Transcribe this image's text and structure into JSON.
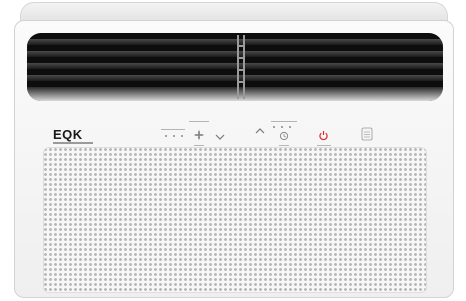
{
  "product": {
    "brand_logo": "EQK",
    "colors": {
      "body": "#f4f4f4",
      "vent": "#0d0d0d",
      "grille_holes": "#b9b9b9",
      "power_accent": "#d82a2a"
    }
  },
  "control_panel": {
    "icons": [
      "fan-icon",
      "chevron-down-icon",
      "chevron-up-icon",
      "timer-icon",
      "power-icon",
      "filter-icon"
    ]
  }
}
